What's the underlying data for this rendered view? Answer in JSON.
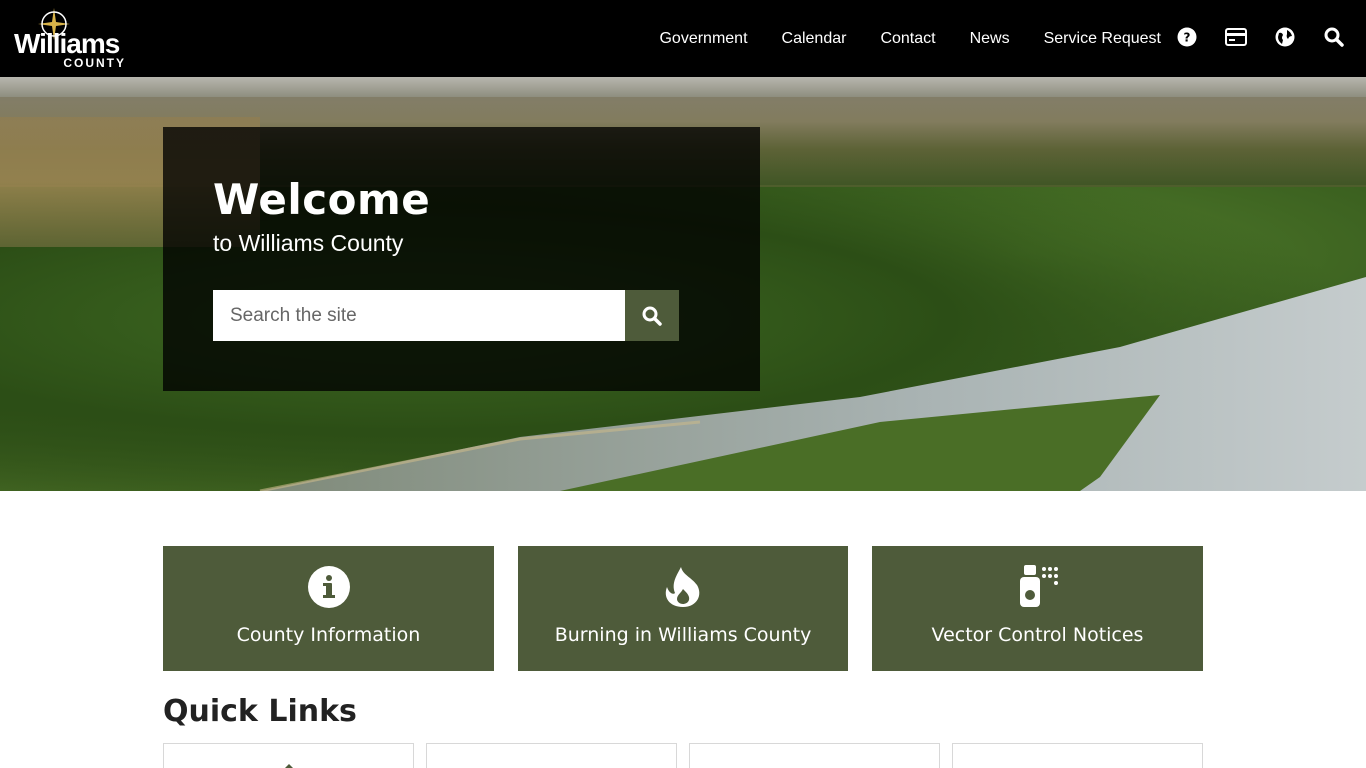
{
  "header": {
    "logo": {
      "word": "Williams",
      "sub": "COUNTY"
    },
    "nav": [
      "Government",
      "Calendar",
      "Contact",
      "News",
      "Service Request"
    ],
    "icons": [
      "help-icon",
      "payment-card-icon",
      "translate-globe-icon",
      "search-icon"
    ]
  },
  "hero": {
    "title": "Welcome",
    "subtitle": "to Williams County",
    "search_placeholder": "Search the site"
  },
  "cards": [
    {
      "label": "County Information",
      "icon": "info-icon"
    },
    {
      "label": "Burning in Williams County",
      "icon": "fire-icon"
    },
    {
      "label": "Vector Control Notices",
      "icon": "spray-icon"
    }
  ],
  "quick_links": {
    "title": "Quick Links"
  },
  "colors": {
    "header_bg": "#000000",
    "accent_green": "#4e5b3a",
    "text_dark": "#222222"
  }
}
